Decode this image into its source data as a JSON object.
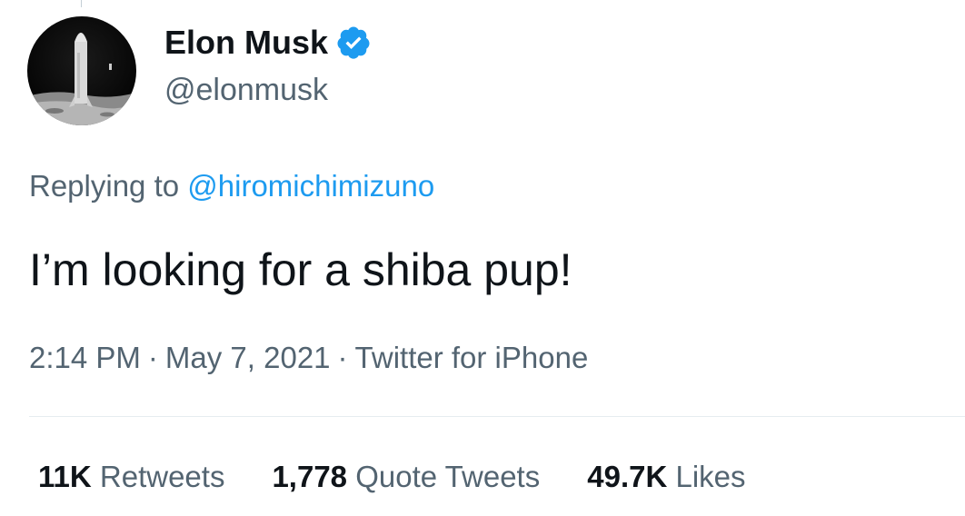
{
  "author": {
    "name": "Elon Musk",
    "handle": "@elonmusk",
    "verified": true
  },
  "reply": {
    "prefix": "Replying to",
    "mention": "@hiromichimizuno"
  },
  "tweet": {
    "text": "I’m looking for a shiba pup!"
  },
  "meta": {
    "time": "2:14 PM",
    "separator": "·",
    "date": "May 7, 2021",
    "source": "Twitter for iPhone"
  },
  "stats": [
    {
      "count": "11K",
      "label": "Retweets"
    },
    {
      "count": "1,778",
      "label": "Quote Tweets"
    },
    {
      "count": "49.7K",
      "label": "Likes"
    }
  ],
  "colors": {
    "accent": "#1d9bf0",
    "secondary_text": "#536471",
    "primary_text": "#0f1419"
  }
}
